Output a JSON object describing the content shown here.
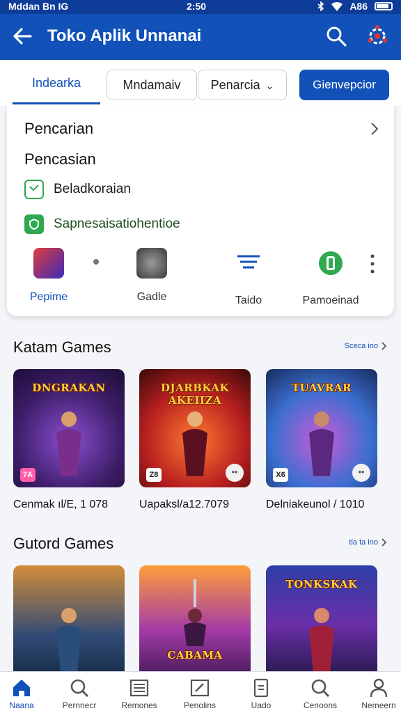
{
  "status_bar": {
    "left": "Mddan  Bn IG",
    "time": "2:50",
    "right": "A86"
  },
  "app_bar": {
    "title": "Toko Aplik Unnanai"
  },
  "tabs": {
    "active": "Indearka",
    "chip1": "Mndamaiv",
    "chip2": "Penarcia",
    "button": "Gienvepcior"
  },
  "menu": {
    "item1": "Pencarian",
    "item2": "Pencasian",
    "item3": "Beladkoraian",
    "item4": "Sapnesaisatiohentioe"
  },
  "categories": [
    {
      "label": "Pepime"
    },
    {
      "label": "Gadle"
    },
    {
      "label": "Taido"
    },
    {
      "label": "Pamoeinad"
    }
  ],
  "sections": {
    "first": {
      "title": "Katam Games",
      "see_all": "Sceca ino"
    },
    "second": {
      "title": "Gutord Games",
      "see_all": "tia ta ino"
    }
  },
  "games_row1": [
    {
      "art_title": "DNGRAKAN",
      "badge": "7A",
      "label": "Cenmak ıl/E, 1 078"
    },
    {
      "art_title": "DJARBKAK AKEIIZA",
      "badge": "Z8",
      "label": "Uapaksl/a12.7079"
    },
    {
      "art_title": "TUAVRAR",
      "badge": "X6",
      "label": "Delniakeunol / 1010"
    }
  ],
  "games_row2": [
    {
      "art_title": ""
    },
    {
      "art_title": "CABAMA"
    },
    {
      "art_title": "TONKSKAK"
    }
  ],
  "bottom_nav": [
    {
      "label": "Naana"
    },
    {
      "label": "Pernnecr"
    },
    {
      "label": "Remones"
    },
    {
      "label": "Penolins"
    },
    {
      "label": "Uado"
    },
    {
      "label": "Cenoons"
    },
    {
      "label": "Nemeern"
    }
  ],
  "colors": {
    "primary": "#1151b8",
    "status_bar": "#0d3c99",
    "green": "#2fa84f"
  }
}
